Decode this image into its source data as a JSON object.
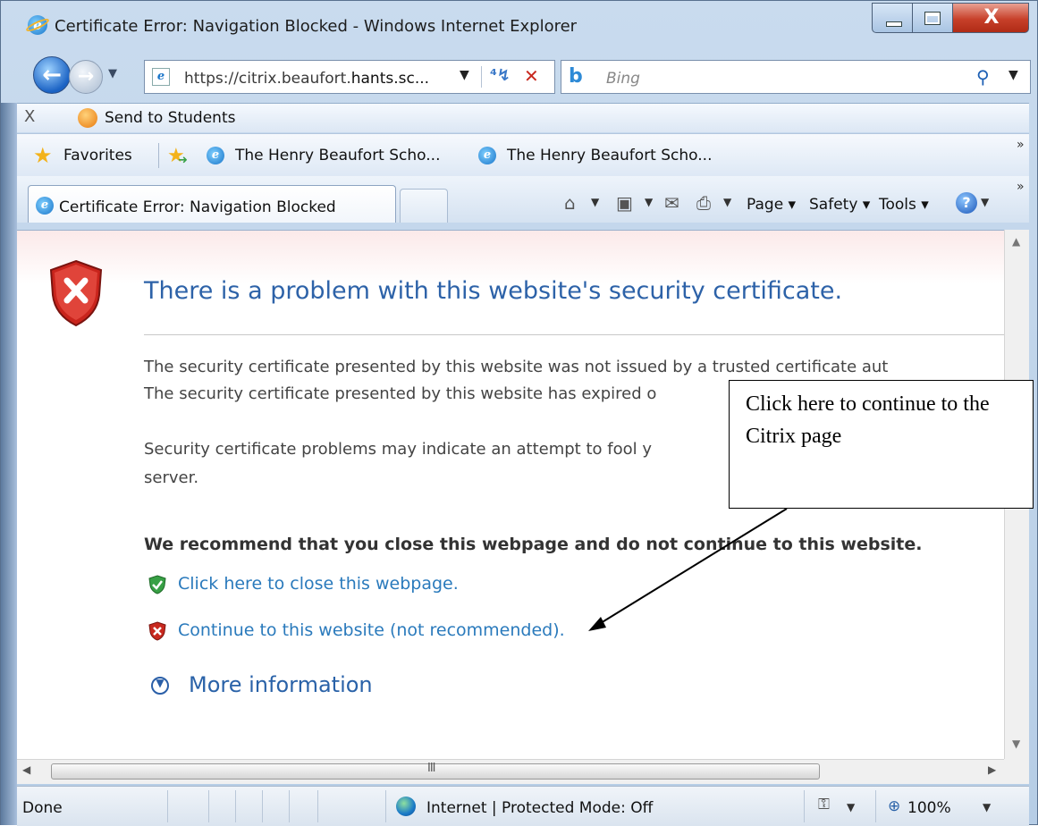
{
  "window": {
    "title": "Certificate Error: Navigation Blocked - Windows Internet Explorer",
    "close_glyph": "X"
  },
  "navbar": {
    "address_url_prefix": "https://citrix.beaufort.",
    "address_url_bold": "hants.sc...",
    "search_placeholder": "Bing"
  },
  "toolbar": {
    "close_glyph": "X",
    "send_to_students": "Send to Students"
  },
  "favorites_bar": {
    "favorites_label": "Favorites",
    "links": [
      "The Henry Beaufort Scho...",
      "The Henry Beaufort Scho..."
    ]
  },
  "tabs": {
    "active_label": "Certificate Error: Navigation Blocked"
  },
  "command_bar": {
    "page_label": "Page",
    "safety_label": "Safety",
    "tools_label": "Tools"
  },
  "content": {
    "heading": "There is a problem with this website's security certificate.",
    "para1_line1": "The security certificate presented by this website was not issued by a trusted certificate aut",
    "para1_line2": "The security certificate presented by this website has expired o",
    "para2_line1": "Security certificate problems may indicate an attempt to fool y",
    "para2_line2": "server.",
    "recommendation": "We recommend that you close this webpage and do not continue to this website.",
    "close_link": "Click here to close this webpage.",
    "continue_link": "Continue to this website (not recommended).",
    "more_info": "More information"
  },
  "status_bar": {
    "status": "Done",
    "zone": "Internet | Protected Mode: Off",
    "zoom": "100%"
  },
  "annotation": {
    "callout_text": "Click here to continue to the Citrix page"
  },
  "colors": {
    "heading_blue": "#2d62a8",
    "link_blue": "#2a7abc",
    "error_red": "#c8281e",
    "safe_green": "#38a045"
  }
}
